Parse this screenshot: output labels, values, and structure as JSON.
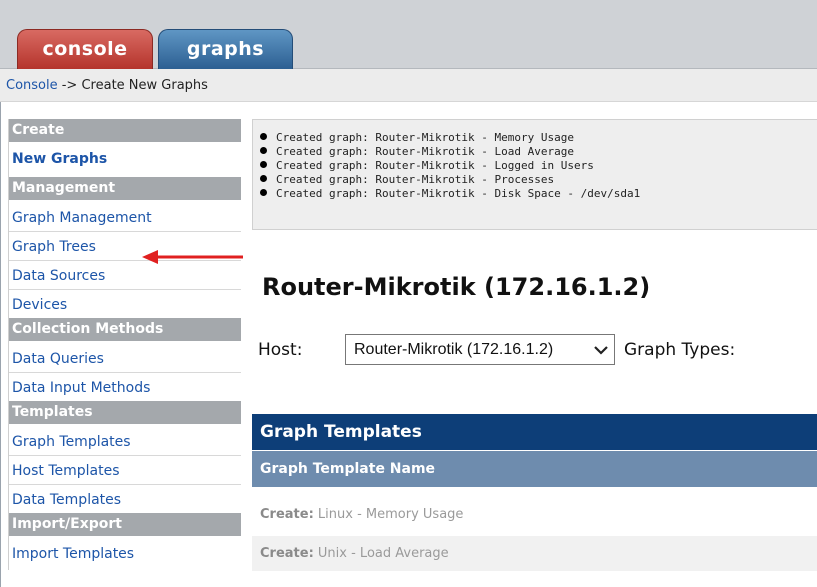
{
  "tabs": [
    {
      "label": "console",
      "color": "#c0433a"
    },
    {
      "label": "graphs",
      "color": "#3d72a8"
    }
  ],
  "breadcrumb": {
    "link": "Console",
    "separator": " -> ",
    "current": "Create New Graphs"
  },
  "sidebar": {
    "sections": [
      {
        "header": "Create",
        "items": [
          {
            "label": "New Graphs",
            "selected": true
          }
        ]
      },
      {
        "header": "Management",
        "items": [
          {
            "label": "Graph Management"
          },
          {
            "label": "Graph Trees"
          },
          {
            "label": "Data Sources"
          },
          {
            "label": "Devices"
          }
        ]
      },
      {
        "header": "Collection Methods",
        "items": [
          {
            "label": "Data Queries"
          },
          {
            "label": "Data Input Methods"
          }
        ]
      },
      {
        "header": "Templates",
        "items": [
          {
            "label": "Graph Templates"
          },
          {
            "label": "Host Templates"
          },
          {
            "label": "Data Templates"
          }
        ]
      },
      {
        "header": "Import/Export",
        "items": [
          {
            "label": "Import Templates"
          }
        ]
      }
    ]
  },
  "messages": [
    "Created graph: Router-Mikrotik - Memory Usage",
    "Created graph: Router-Mikrotik - Load Average",
    "Created graph: Router-Mikrotik - Logged in Users",
    "Created graph: Router-Mikrotik - Processes",
    "Created graph: Router-Mikrotik - Disk Space - /dev/sda1"
  ],
  "host_title": "Router-Mikrotik (172.16.1.2)",
  "host_form": {
    "host_label": "Host:",
    "host_value": "Router-Mikrotik (172.16.1.2)",
    "graph_types_label": "Graph Types:"
  },
  "graph_templates": {
    "header": "Graph Templates",
    "column": "Graph Template Name",
    "rows": [
      {
        "prefix": "Create:",
        "name": "Linux - Memory Usage"
      },
      {
        "prefix": "Create:",
        "name": "Unix - Load Average"
      }
    ]
  },
  "annotation": {
    "arrow_target": "Graph Trees",
    "arrow_color": "#e02020"
  }
}
